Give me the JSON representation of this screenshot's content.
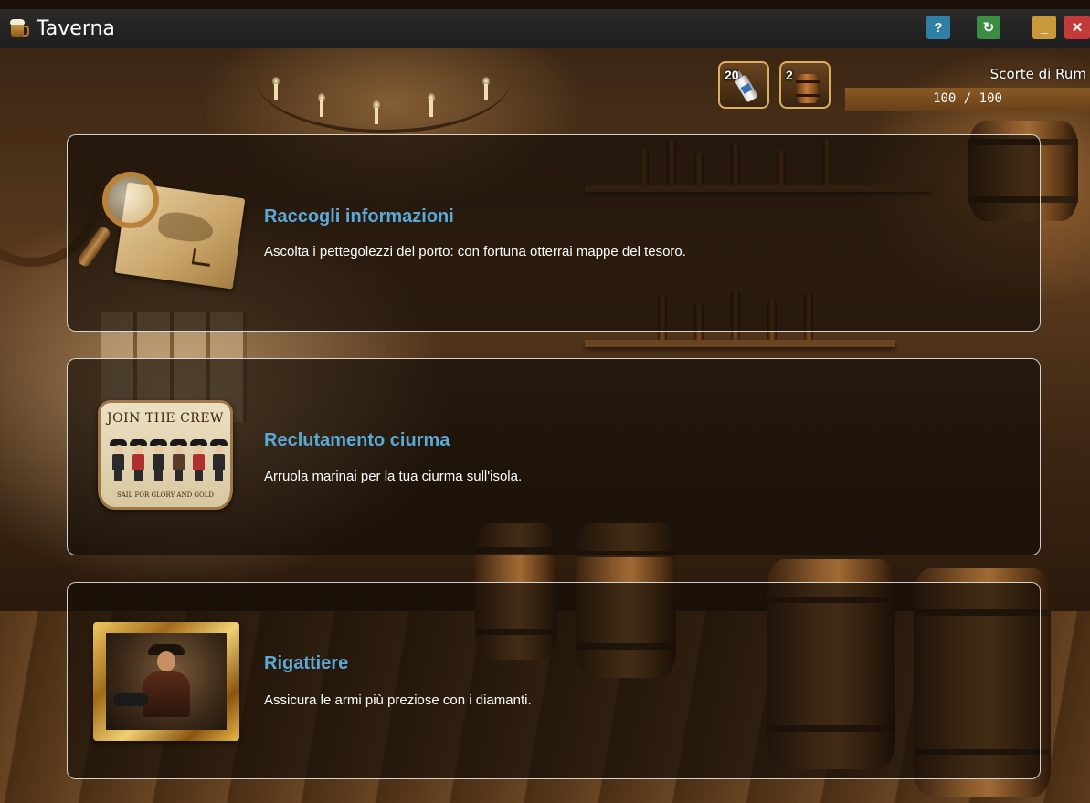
{
  "window": {
    "title": "Taverna",
    "icon": "beer-mug-icon",
    "buttons": {
      "help": "?",
      "refresh": "↻",
      "minimize": "_",
      "close": "✕"
    }
  },
  "resources": [
    {
      "count": "20",
      "icon": "rum-bottle-icon"
    },
    {
      "count": "2",
      "icon": "barrel-icon"
    }
  ],
  "rum_supply": {
    "label": "Scorte di Rum",
    "value_text": "100 / 100",
    "current": 100,
    "max": 100
  },
  "cards": [
    {
      "title": "Raccogli informazioni",
      "description": "Ascolta i pettegolezzi del porto: con fortuna otterrai mappe del tesoro.",
      "image": "treasure-map-magnifier"
    },
    {
      "title": "Reclutamento ciurma",
      "description": "Arruola marinai per la tua ciurma sull'isola.",
      "image": "join-the-crew-sign",
      "image_text": {
        "headline": "JOIN THE CREW",
        "footer": "SAIL FOR GLORY AND GOLD"
      }
    },
    {
      "title": "Rigattiere",
      "description": "Assicura le armi più preziose con i diamanti.",
      "image": "pirate-portrait-frame"
    }
  ],
  "colors": {
    "card_title": "#5aa9d6",
    "help_button": "#2f7fa6",
    "refresh_button": "#3b8d43",
    "minimize_button": "#c89a3a",
    "close_button": "#c23a3a"
  }
}
